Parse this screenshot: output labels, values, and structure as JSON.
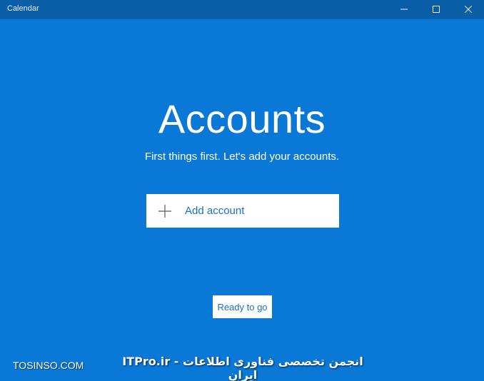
{
  "window": {
    "title": "Calendar",
    "controls": {
      "minimize_icon": "minimize-icon",
      "maximize_icon": "maximize-icon",
      "close_icon": "close-icon"
    }
  },
  "main": {
    "heading": "Accounts",
    "subtitle": "First things first. Let's add your accounts.",
    "add_account": {
      "icon": "plus-icon",
      "label": "Add account"
    },
    "ready_button": "Ready to go"
  },
  "watermarks": {
    "left": "TOSINSO.COM",
    "center": "ITPro.ir - انجمن تخصصی فناوری اطلاعات ایران"
  },
  "colors": {
    "background": "#0a78d7",
    "titlebar": "#0a5ea8",
    "accent_text": "#1a6fbf",
    "button_bg": "#ffffff"
  }
}
